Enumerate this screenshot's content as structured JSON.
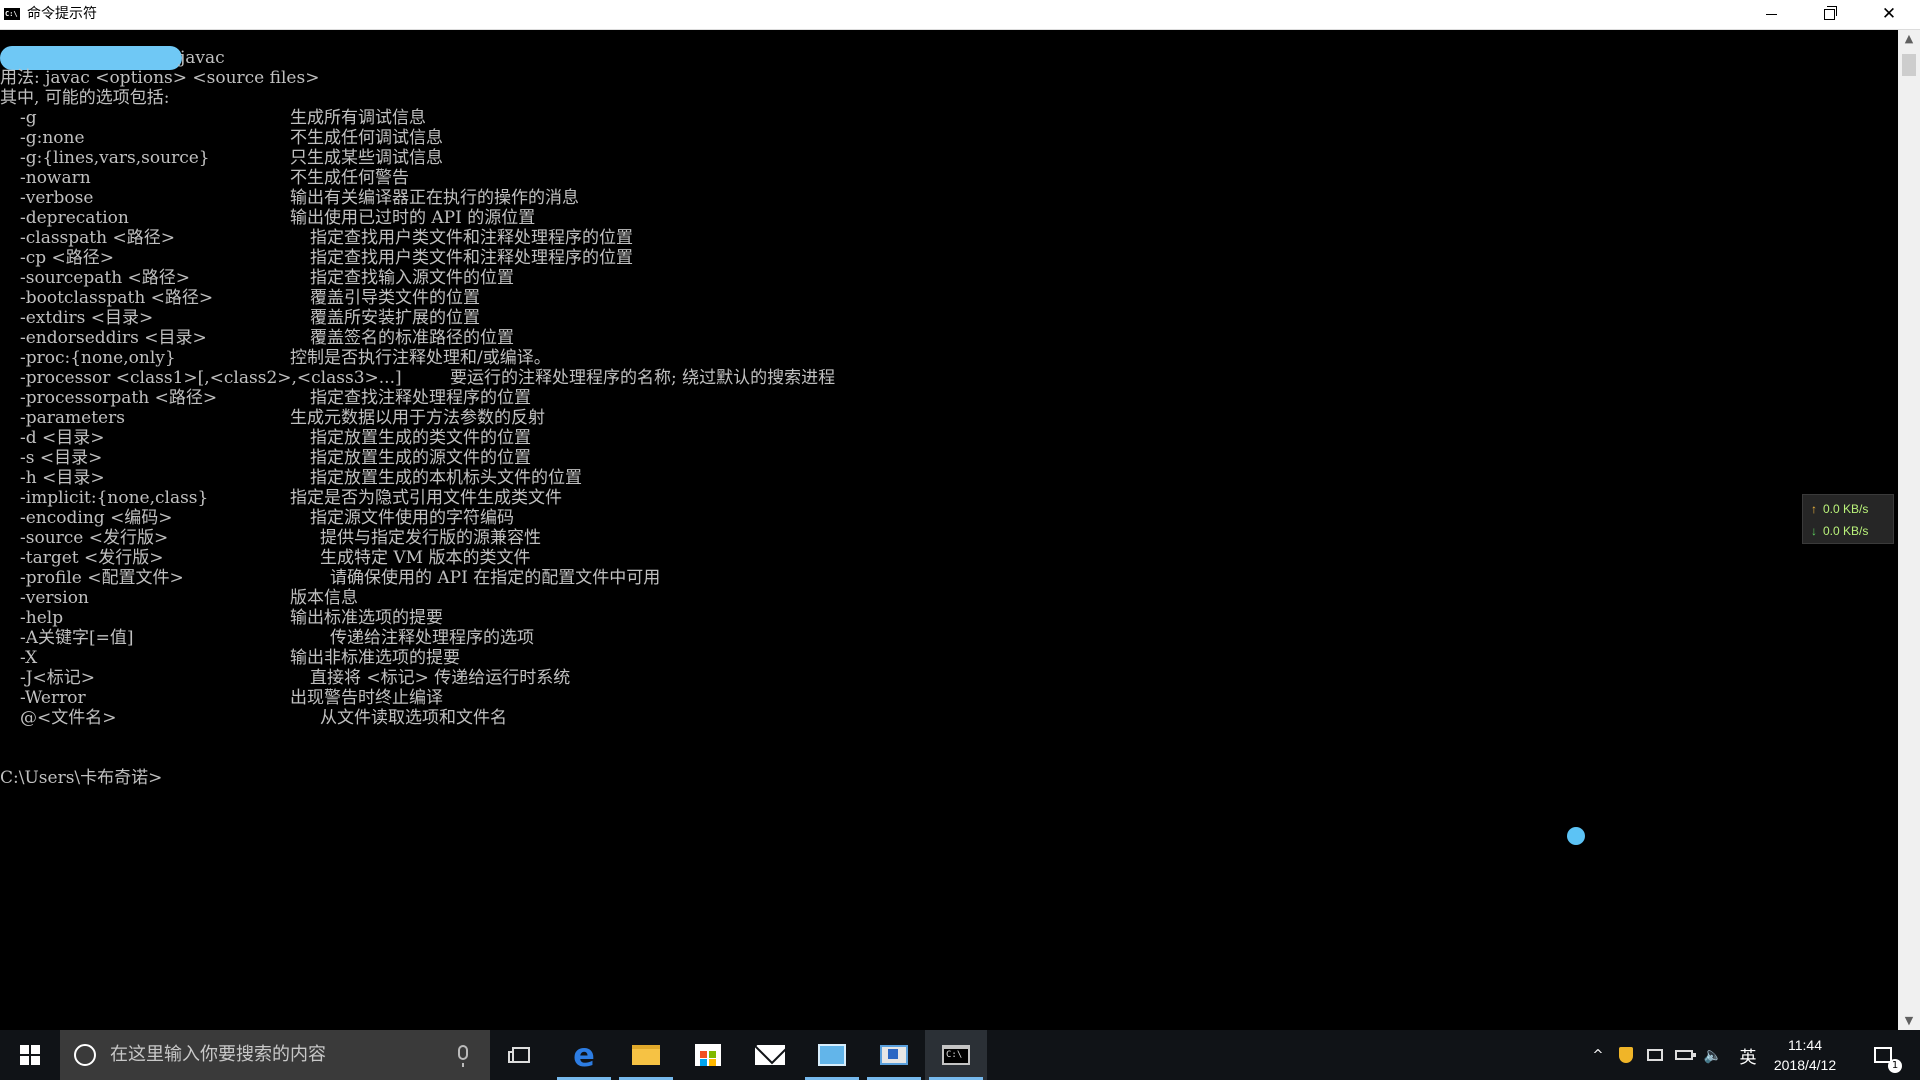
{
  "window": {
    "title": "命令提示符",
    "icon_label": "C:\\",
    "minimize_icon": "minimize-icon",
    "maximize_icon": "restore-icon",
    "close_label": "✕"
  },
  "console": {
    "lines": [
      "javac",
      "用法: javac <options> <source files>",
      "其中, 可能的选项包括:"
    ],
    "options": [
      {
        "opt": "-g",
        "desc": "生成所有调试信息"
      },
      {
        "opt": "-g:none",
        "desc": "不生成任何调试信息"
      },
      {
        "opt": "-g:{lines,vars,source}",
        "desc": "只生成某些调试信息"
      },
      {
        "opt": "-nowarn",
        "desc": "不生成任何警告"
      },
      {
        "opt": "-verbose",
        "desc": "输出有关编译器正在执行的操作的消息"
      },
      {
        "opt": "-deprecation",
        "desc": "输出使用已过时的 API 的源位置"
      },
      {
        "opt": "-classpath <路径>",
        "desc": "指定查找用户类文件和注释处理程序的位置"
      },
      {
        "opt": "-cp <路径>",
        "desc": "指定查找用户类文件和注释处理程序的位置"
      },
      {
        "opt": "-sourcepath <路径>",
        "desc": "指定查找输入源文件的位置"
      },
      {
        "opt": "-bootclasspath <路径>",
        "desc": "覆盖引导类文件的位置"
      },
      {
        "opt": "-extdirs <目录>",
        "desc": "覆盖所安装扩展的位置"
      },
      {
        "opt": "-endorseddirs <目录>",
        "desc": "覆盖签名的标准路径的位置"
      },
      {
        "opt": "-proc:{none,only}",
        "desc": "控制是否执行注释处理和/或编译。"
      },
      {
        "opt": "-processor <class1>[,<class2>,<class3>...]",
        "desc": "要运行的注释处理程序的名称; 绕过默认的搜索进程"
      },
      {
        "opt": "-processorpath <路径>",
        "desc": "指定查找注释处理程序的位置"
      },
      {
        "opt": "-parameters",
        "desc": "生成元数据以用于方法参数的反射"
      },
      {
        "opt": "-d <目录>",
        "desc": "指定放置生成的类文件的位置"
      },
      {
        "opt": "-s <目录>",
        "desc": "指定放置生成的源文件的位置"
      },
      {
        "opt": "-h <目录>",
        "desc": "指定放置生成的本机标头文件的位置"
      },
      {
        "opt": "-implicit:{none,class}",
        "desc": "指定是否为隐式引用文件生成类文件"
      },
      {
        "opt": "-encoding <编码>",
        "desc": "指定源文件使用的字符编码"
      },
      {
        "opt": "-source <发行版>",
        "desc": "提供与指定发行版的源兼容性"
      },
      {
        "opt": "-target <发行版>",
        "desc": "生成特定 VM 版本的类文件"
      },
      {
        "opt": "-profile <配置文件>",
        "desc": "请确保使用的 API 在指定的配置文件中可用"
      },
      {
        "opt": "-version",
        "desc": "版本信息"
      },
      {
        "opt": "-help",
        "desc": "输出标准选项的提要"
      },
      {
        "opt": "-A关键字[=值]",
        "desc": "传递给注释处理程序的选项"
      },
      {
        "opt": "-X",
        "desc": "输出非标准选项的提要"
      },
      {
        "opt": "-J<标记>",
        "desc": "直接将 <标记> 传递给运行时系统"
      },
      {
        "opt": "-Werror",
        "desc": "出现警告时终止编译"
      },
      {
        "opt": "@<文件名>",
        "desc": "从文件读取选项和文件名"
      }
    ],
    "prompt": "C:\\Users\\卡布奇诺>"
  },
  "scrollbar": {
    "up_icon": "▲",
    "down_icon": "▼"
  },
  "netspeed": {
    "up_arrow": "↑",
    "down_arrow": "↓",
    "upload": "0.0 KB/s",
    "download": "0.0 KB/s"
  },
  "taskbar": {
    "search_placeholder": "在这里输入你要搜索的内容",
    "cmd_icon_label": "C:\\",
    "tray": {
      "chevron": "^",
      "volume": "🔈",
      "ime": "英",
      "time": "11:44",
      "date": "2018/4/12",
      "notification_count": "1"
    }
  },
  "colors": {
    "console_bg": "#000000",
    "console_text": "#c0c0c0",
    "taskbar_bg": "#101317",
    "accent": "#76b9ed",
    "netspeed_text": "#b9f27a"
  }
}
